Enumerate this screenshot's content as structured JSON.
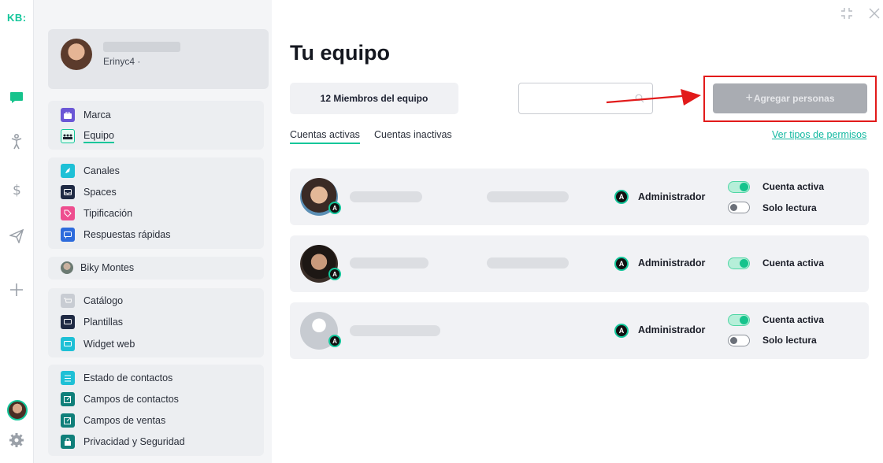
{
  "app": {
    "logo": "KB:"
  },
  "profile": {
    "username": "Erinyc4 ·"
  },
  "sidebar": {
    "group1": [
      {
        "label": "Marca",
        "icon": "briefcase-icon",
        "color": "#6b57d6"
      },
      {
        "label": "Equipo",
        "icon": "team-icon",
        "color": "#12c69a",
        "active": true
      }
    ],
    "group2": [
      {
        "label": "Canales",
        "icon": "rocket-icon",
        "color": "#1ec0d6"
      },
      {
        "label": "Spaces",
        "icon": "inbox-icon",
        "color": "#1f2a44"
      },
      {
        "label": "Tipificación",
        "icon": "tag-icon",
        "color": "#ee4e8f"
      },
      {
        "label": "Respuestas rápidas",
        "icon": "quick-reply-icon",
        "color": "#2d6bdc"
      }
    ],
    "bot": {
      "label": "Biky Montes"
    },
    "group3": [
      {
        "label": "Catálogo",
        "icon": "cart-icon",
        "color": "#c8ccd3"
      },
      {
        "label": "Plantillas",
        "icon": "template-icon",
        "color": "#1f2a44"
      },
      {
        "label": "Widget web",
        "icon": "chat-widget-icon",
        "color": "#1ec0d6"
      }
    ],
    "group4": [
      {
        "label": "Estado de contactos",
        "icon": "list-icon",
        "color": "#1ec0d6"
      },
      {
        "label": "Campos de contactos",
        "icon": "edit-icon",
        "color": "#0f7f7a"
      },
      {
        "label": "Campos de ventas",
        "icon": "edit-icon",
        "color": "#0f7f7a"
      },
      {
        "label": "Privacidad y Seguridad",
        "icon": "lock-icon",
        "color": "#0f7f7a"
      }
    ]
  },
  "main": {
    "title": "Tu equipo",
    "members_count": "12 Miembros del equipo",
    "search_placeholder": "",
    "add_button": "Agregar personas",
    "add_button_prefix": "+",
    "tabs": [
      {
        "label": "Cuentas activas",
        "active": true
      },
      {
        "label": "Cuentas inactivas",
        "active": false
      }
    ],
    "permissions_link": "Ver tipos de permisos",
    "members": [
      {
        "badge": "A",
        "role_badge": "A",
        "role": "Administrador",
        "status_label": "Cuenta activa",
        "active": true,
        "readonly_label": "Solo lectura",
        "readonly": false
      },
      {
        "badge": "A",
        "role_badge": "A",
        "role": "Administrador",
        "status_label": "Cuenta activa",
        "active": true
      },
      {
        "badge": "A",
        "role_badge": "A",
        "role": "Administrador",
        "status_label": "Cuenta activa",
        "active": true,
        "readonly_label": "Solo lectura",
        "readonly": false
      }
    ]
  },
  "colors": {
    "accent": "#12c69a",
    "highlight": "#e21a1a",
    "button_disabled": "#a9acb2"
  }
}
